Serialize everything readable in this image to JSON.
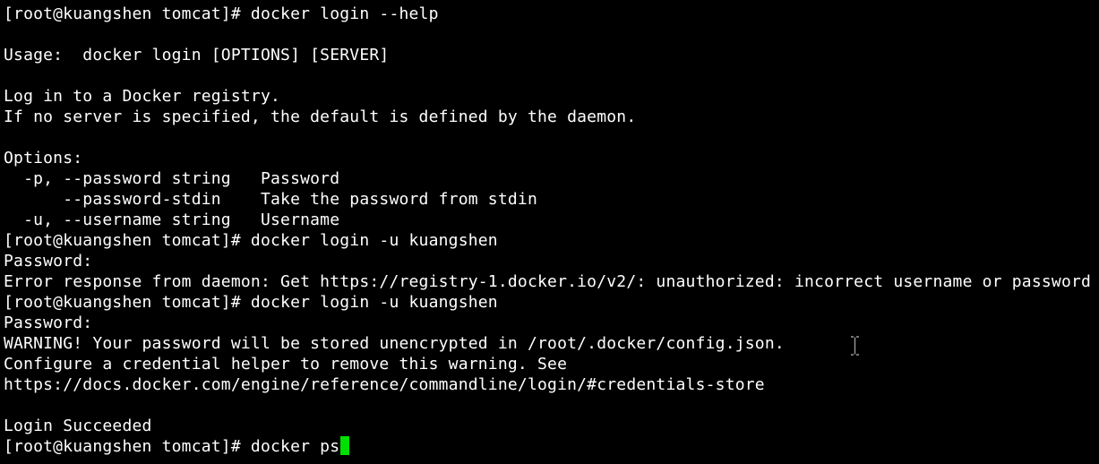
{
  "terminal": {
    "lines": [
      {
        "text": "[root@kuangshen tomcat]# docker login --help"
      },
      {
        "text": ""
      },
      {
        "text": "Usage:  docker login [OPTIONS] [SERVER]"
      },
      {
        "text": ""
      },
      {
        "text": "Log in to a Docker registry."
      },
      {
        "text": "If no server is specified, the default is defined by the daemon."
      },
      {
        "text": ""
      },
      {
        "text": "Options:"
      },
      {
        "text": "  -p, --password string   Password"
      },
      {
        "text": "      --password-stdin    Take the password from stdin"
      },
      {
        "text": "  -u, --username string   Username"
      },
      {
        "text": "[root@kuangshen tomcat]# docker login -u kuangshen"
      },
      {
        "text": "Password:"
      },
      {
        "text": "Error response from daemon: Get https://registry-1.docker.io/v2/: unauthorized: incorrect username or password"
      },
      {
        "text": "[root@kuangshen tomcat]# docker login -u kuangshen"
      },
      {
        "text": "Password:"
      },
      {
        "text": "WARNING! Your password will be stored unencrypted in /root/.docker/config.json."
      },
      {
        "text": "Configure a credential helper to remove this warning. See"
      },
      {
        "text": "https://docs.docker.com/engine/reference/commandline/login/#credentials-store"
      },
      {
        "text": ""
      },
      {
        "text": "Login Succeeded"
      }
    ],
    "current_input_line": "[root@kuangshen tomcat]# docker ps",
    "cursor_color": "#00e000",
    "background": "#000000",
    "foreground": "#ffffff",
    "mouse_cursor_icon": "text-ibeam-icon"
  }
}
